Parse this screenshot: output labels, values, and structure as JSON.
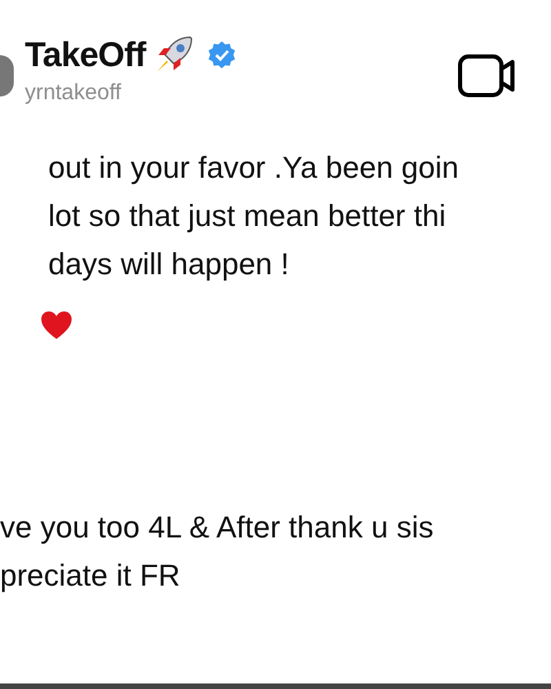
{
  "header": {
    "name": "TakeOff",
    "verified": true,
    "username": "yrntakeoff"
  },
  "messages": [
    {
      "lines": [
        "out in your favor .Ya been goin",
        "lot so that just mean better thi",
        "days will happen !"
      ],
      "reaction": true
    },
    {
      "lines": [
        "ve you too 4L & After thank u sis",
        "preciate it FR"
      ],
      "reaction": false
    }
  ]
}
